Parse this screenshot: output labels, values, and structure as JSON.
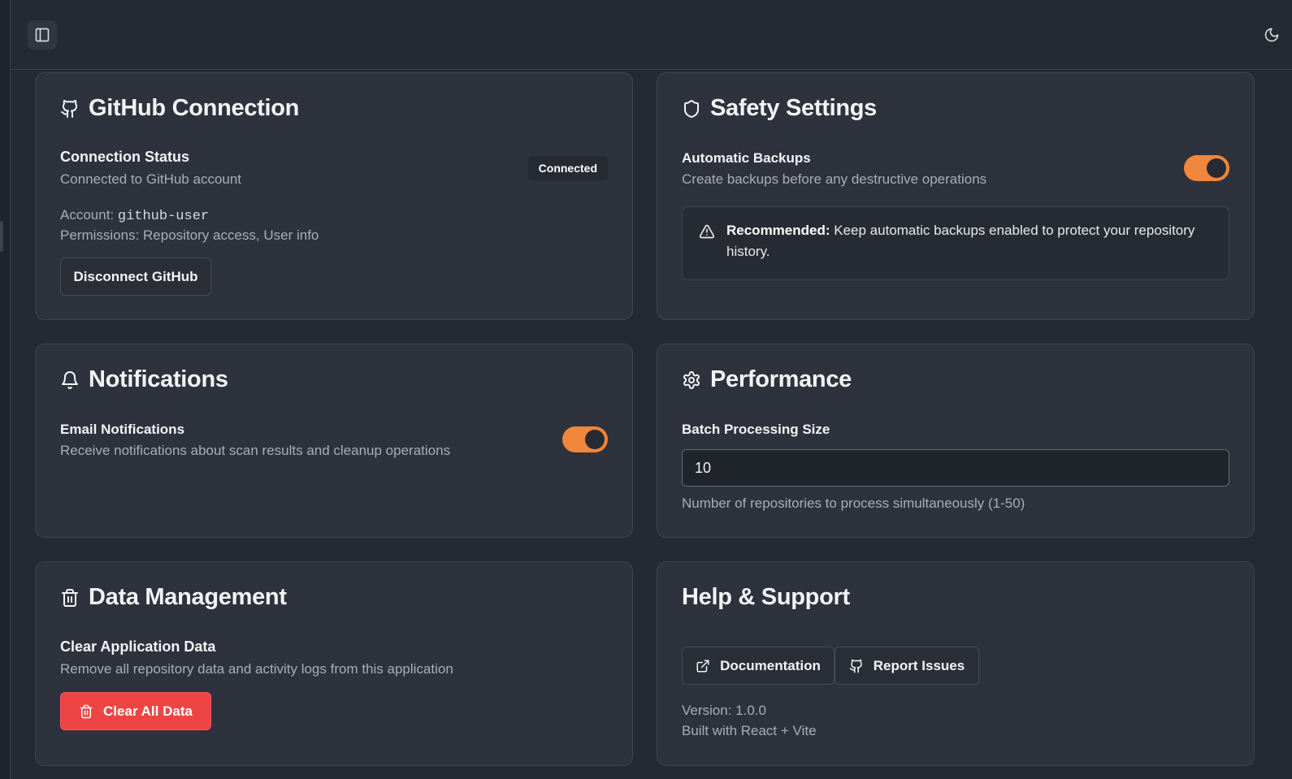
{
  "colors": {
    "background": "#252932",
    "card": "#2e323c",
    "accent_toggle": "#f0873a",
    "danger": "#ef4444",
    "muted_text": "#a9adb5"
  },
  "header": {
    "sidebar_toggle_icon": "panel-left-icon",
    "theme_toggle_icon": "moon-icon"
  },
  "github": {
    "title": "GitHub Connection",
    "icon": "github-icon",
    "status_label": "Connection Status",
    "status_desc": "Connected to GitHub account",
    "badge": "Connected",
    "account_label": "Account: ",
    "account_value": "github-user",
    "permissions": "Permissions: Repository access, User info",
    "disconnect_label": "Disconnect GitHub"
  },
  "safety": {
    "title": "Safety Settings",
    "icon": "shield-icon",
    "backups_label": "Automatic Backups",
    "backups_desc": "Create backups before any destructive operations",
    "backups_enabled": true,
    "alert_icon": "warning-triangle-icon",
    "alert_strong": "Recommended:",
    "alert_text": " Keep automatic backups enabled to protect your repository history."
  },
  "notifications": {
    "title": "Notifications",
    "icon": "bell-icon",
    "email_label": "Email Notifications",
    "email_desc": "Receive notifications about scan results and cleanup operations",
    "email_enabled": true
  },
  "performance": {
    "title": "Performance",
    "icon": "gear-icon",
    "batch_label": "Batch Processing Size",
    "batch_value": "10",
    "batch_hint": "Number of repositories to process simultaneously (1-50)"
  },
  "data_management": {
    "title": "Data Management",
    "icon": "trash-icon",
    "clear_label": "Clear Application Data",
    "clear_desc": "Remove all repository data and activity logs from this application",
    "clear_button": "Clear All Data"
  },
  "help": {
    "title": "Help & Support",
    "docs_label": "Documentation",
    "docs_icon": "external-link-icon",
    "issues_label": "Report Issues",
    "issues_icon": "github-icon",
    "version": "Version: 1.0.0",
    "built_with": "Built with React + Vite"
  }
}
